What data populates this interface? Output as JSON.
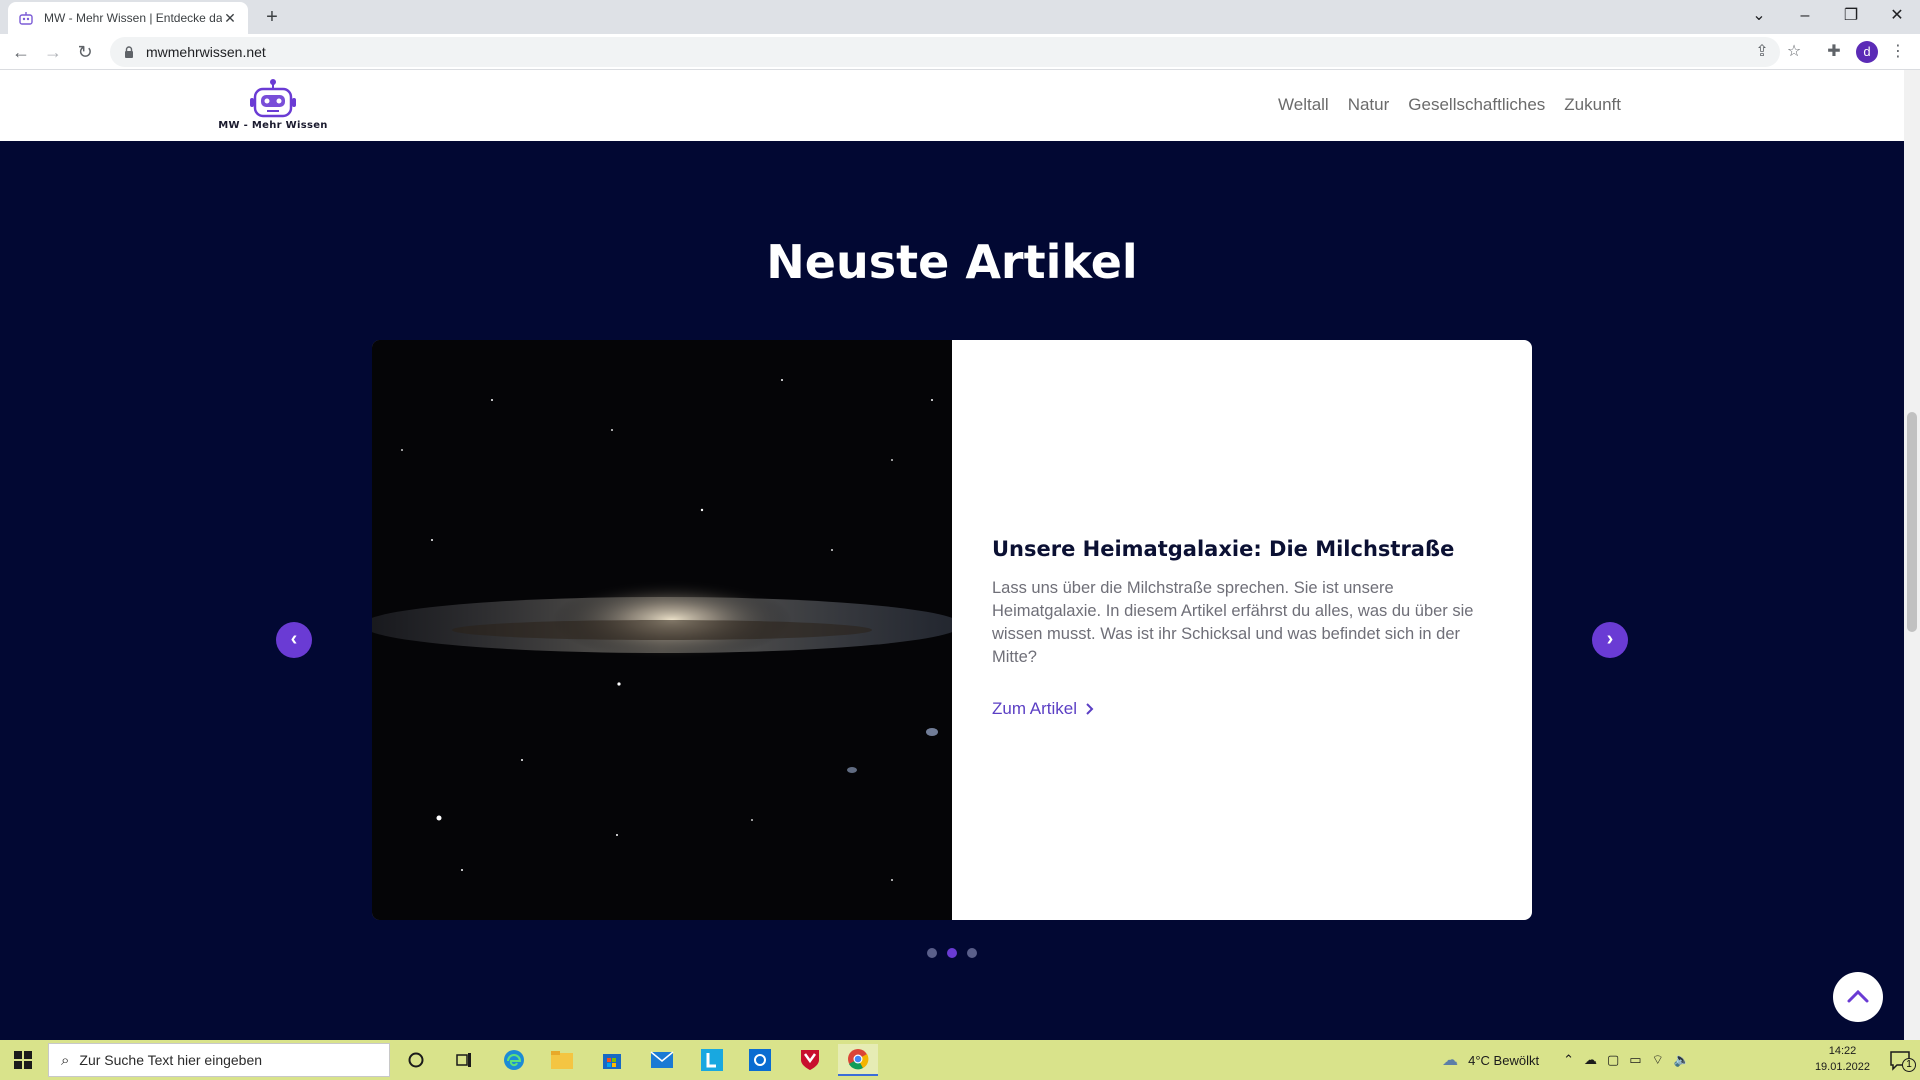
{
  "browser": {
    "tab_title": "MW - Mehr Wissen | Entdecke das",
    "url": "mwmehrwissen.net",
    "profile_initial": "d"
  },
  "site": {
    "logo_text": "MW - Mehr Wissen",
    "menu": [
      "Weltall",
      "Natur",
      "Gesellschaftliches",
      "Zukunft"
    ],
    "accent_color": "#6a3bd4",
    "background_color": "#020833"
  },
  "section": {
    "heading": "Neuste Artikel"
  },
  "article": {
    "title": "Unsere Heimatgalaxie: Die Milchstraße",
    "text": "Lass uns über die Milchstraße sprechen. Sie ist unsere Heimatgalaxie. In diesem Artikel erfährst du alles, was du über sie wissen musst. Was ist ihr Schicksal und was befindet sich in der Mitte?",
    "link_label": "Zum Artikel"
  },
  "carousel": {
    "slides_total": 3,
    "active_slide": 2
  },
  "taskbar": {
    "search_placeholder": "Zur Suche Text hier eingeben",
    "weather": "4°C  Bewölkt",
    "time": "14:22",
    "date": "19.01.2022",
    "notification_count": "1"
  }
}
